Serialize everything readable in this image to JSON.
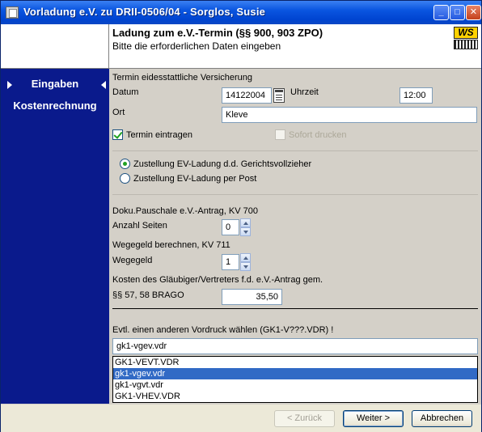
{
  "window": {
    "title": "Vorladung e.V. zu   DRII-0506/04 - Sorglos, Susie",
    "minimize": "_",
    "maximize": "□",
    "close": "✕"
  },
  "header": {
    "title": "Ladung zum e.V.-Termin (§§ 900, 903 ZPO)",
    "subtitle": "Bitte die erforderlichen Daten eingeben",
    "logo_text": "WS"
  },
  "sidebar": {
    "items": [
      {
        "label": "Eingaben",
        "active": true
      },
      {
        "label": "Kostenrechnung",
        "active": false
      }
    ]
  },
  "form": {
    "section_termin": "Termin eidesstattliche Versicherung",
    "datum_label": "Datum",
    "datum_value": "14122004",
    "uhrzeit_label": "Uhrzeit",
    "uhrzeit_value": "12:00",
    "ort_label": "Ort",
    "ort_value": "Kleve",
    "termin_eintragen_label": "Termin eintragen",
    "sofort_drucken_label": "Sofort drucken",
    "radio_gv_label": "Zustellung EV-Ladung d.d. Gerichtsvollzieher",
    "radio_post_label": "Zustellung EV-Ladung per Post",
    "doku_label": "Doku.Pauschale e.V.-Antrag, KV 700",
    "anzahl_seiten_label": "Anzahl Seiten",
    "anzahl_seiten_value": "0",
    "wegegeld_section": "Wegegeld berechnen, KV 711",
    "wegegeld_label": "Wegegeld",
    "wegegeld_value": "1",
    "kosten_label": "Kosten des Gläubiger/Vertreters f.d. e.V.-Antrag gem.",
    "brago_label": "§§ 57, 58 BRAGO",
    "brago_value": "35,50",
    "vordruck_label": "Evtl. einen anderen Vordruck wählen (GK1-V???.VDR) !",
    "vordruck_value": "gk1-vgev.vdr",
    "vordruck_options": [
      "GK1-VEVT.VDR",
      "gk1-vgev.vdr",
      "gk1-vgvt.vdr",
      "GK1-VHEV.VDR"
    ]
  },
  "footer": {
    "back_label": "< Zurück",
    "next_label": "Weiter >",
    "cancel_label": "Abbrechen"
  }
}
